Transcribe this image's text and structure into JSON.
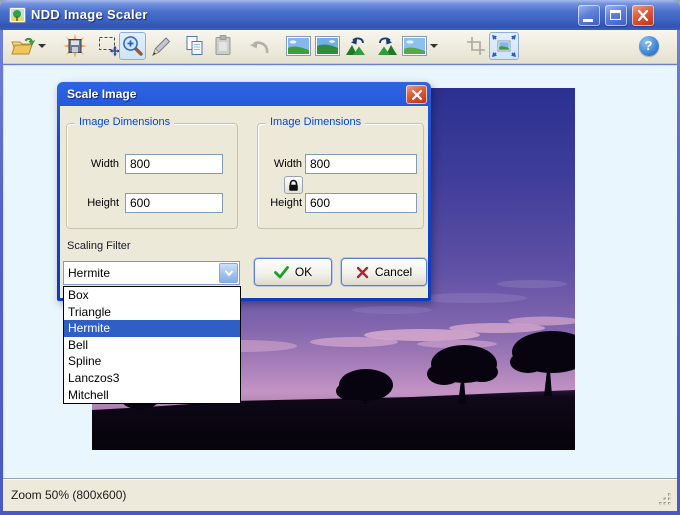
{
  "window": {
    "title": "NDD Image Scaler"
  },
  "toolbar": {
    "help_glyph": "?",
    "tools": [
      "open",
      "save",
      "select",
      "zoom",
      "pencil",
      "copy",
      "paste",
      "undo",
      "image-view-1",
      "image-view-2",
      "rotate-left",
      "rotate-right",
      "image-options",
      "crop",
      "resize",
      "help"
    ],
    "pressed_tools": [
      "zoom",
      "resize"
    ]
  },
  "dialog": {
    "title": "Scale Image",
    "original": {
      "legend": "Image Dimensions",
      "width_label": "Width",
      "width_value": "800",
      "height_label": "Height",
      "height_value": "600"
    },
    "target": {
      "legend": "Image Dimensions",
      "width_label": "Width",
      "width_value": "800",
      "height_label": "Height",
      "height_value": "600",
      "lock_icon": "padlock"
    },
    "filter": {
      "label": "Scaling Filter",
      "value": "Hermite",
      "selected": "Hermite",
      "options": [
        "Box",
        "Triangle",
        "Hermite",
        "Bell",
        "Spline",
        "Lanczos3",
        "Mitchell"
      ]
    },
    "buttons": {
      "ok": "OK",
      "cancel": "Cancel"
    }
  },
  "statusbar": {
    "text": "Zoom 50% (800x600)"
  },
  "colors": {
    "titlebar": "#3E64C4",
    "dialog_border": "#1747CC",
    "selection": "#2F5FC5",
    "client_bg": "#EAF6FE",
    "chrome_bg": "#ECE9D8",
    "group_label": "#0046D5"
  }
}
